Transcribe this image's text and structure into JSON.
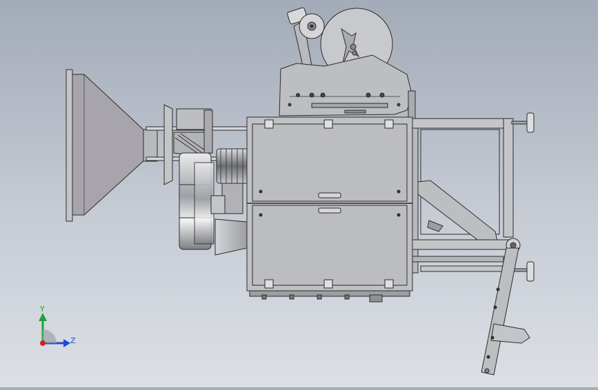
{
  "viewport": {
    "background_top": "#a3abb8",
    "background_bottom": "#dcdfe5"
  },
  "triad": {
    "y_label": "Y",
    "z_label": "Z",
    "y_color": "#1fa33a",
    "z_color": "#1f4ad6",
    "x_color": "#d42020"
  },
  "colors": {
    "metal": "#c4c5c8",
    "metal_dark": "#8e9095",
    "cone": "#a7a4ab",
    "outline": "#2b2b2b"
  }
}
